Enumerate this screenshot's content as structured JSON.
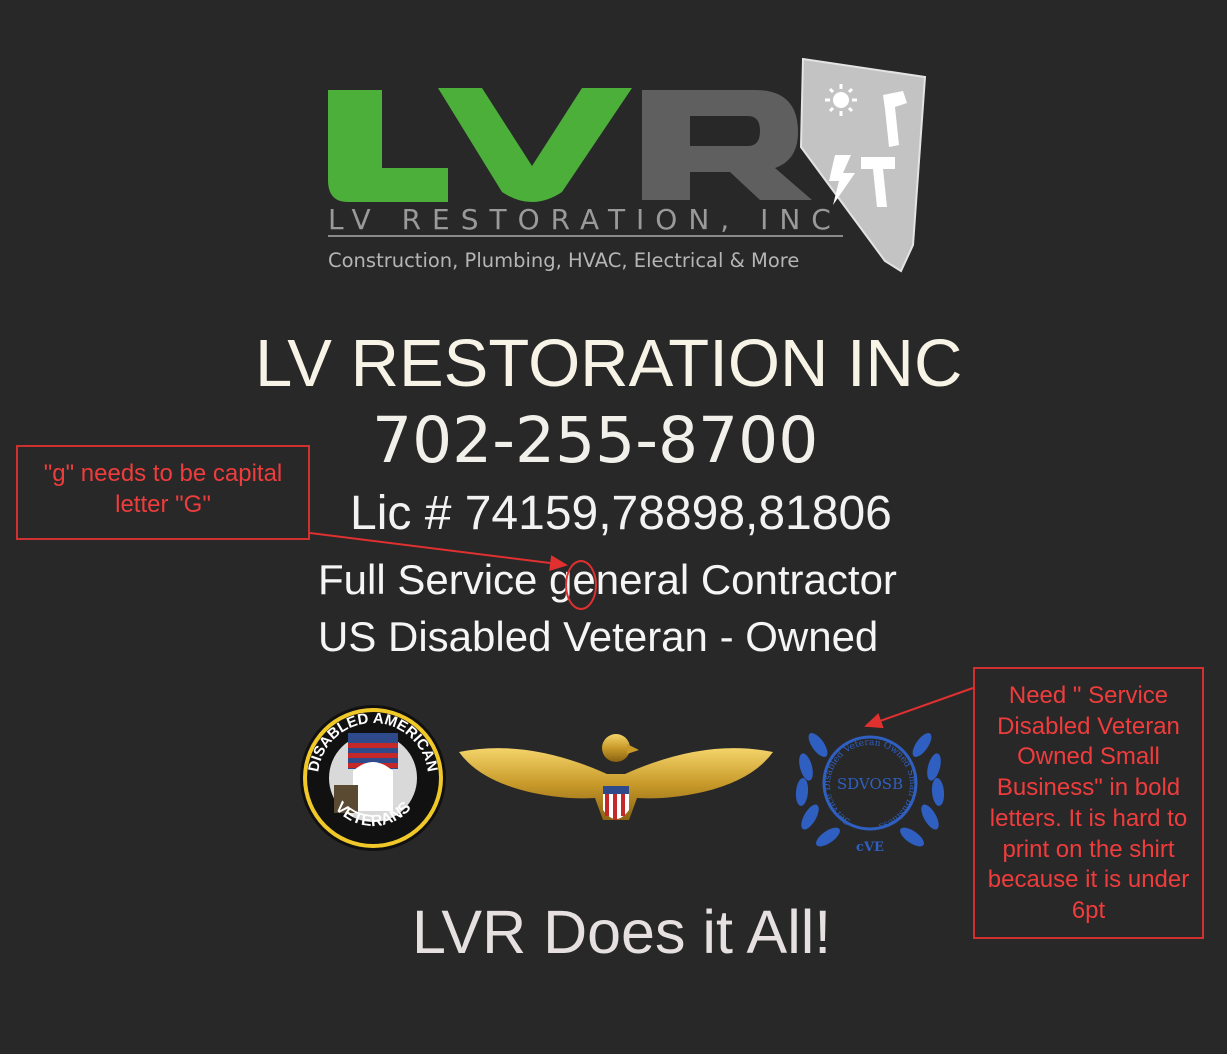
{
  "logo": {
    "mark_text": "LVR",
    "company_line": "LV RESTORATION, INC",
    "services_line": "Construction, Plumbing, HVAC, Electrical & More",
    "colors": {
      "green": "#4caf3a",
      "gray": "#5e5e5e",
      "shield": "#c8c8c8"
    },
    "icons": [
      "sun-icon",
      "wrench-icon",
      "lightning-icon",
      "hammer-icon"
    ]
  },
  "content": {
    "title": "LV RESTORATION INC",
    "phone": "702-255-8700",
    "license": "Lic # 74159,78898,81806",
    "service_line": "Full Service general Contractor",
    "veteran_line": "US Disabled Veteran - Owned",
    "tagline": "LVR Does it All!"
  },
  "badges": {
    "dav": {
      "top": "DISABLED AMERICAN",
      "bottom": "VETERANS"
    },
    "sdvosb": {
      "center": "SDVOSB",
      "ring": "Service Disabled Veteran Owned Small Business",
      "bottom": "cVE",
      "color": "#2f5fc0"
    }
  },
  "annotations": {
    "note_g": "\"g\" needs to be capital letter \"G\"",
    "note_sdvosb": "Need \" Service Disabled Veteran Owned Small Business\" in bold letters. It is hard to print on the shirt because it is under 6pt",
    "color": "#e03030"
  }
}
